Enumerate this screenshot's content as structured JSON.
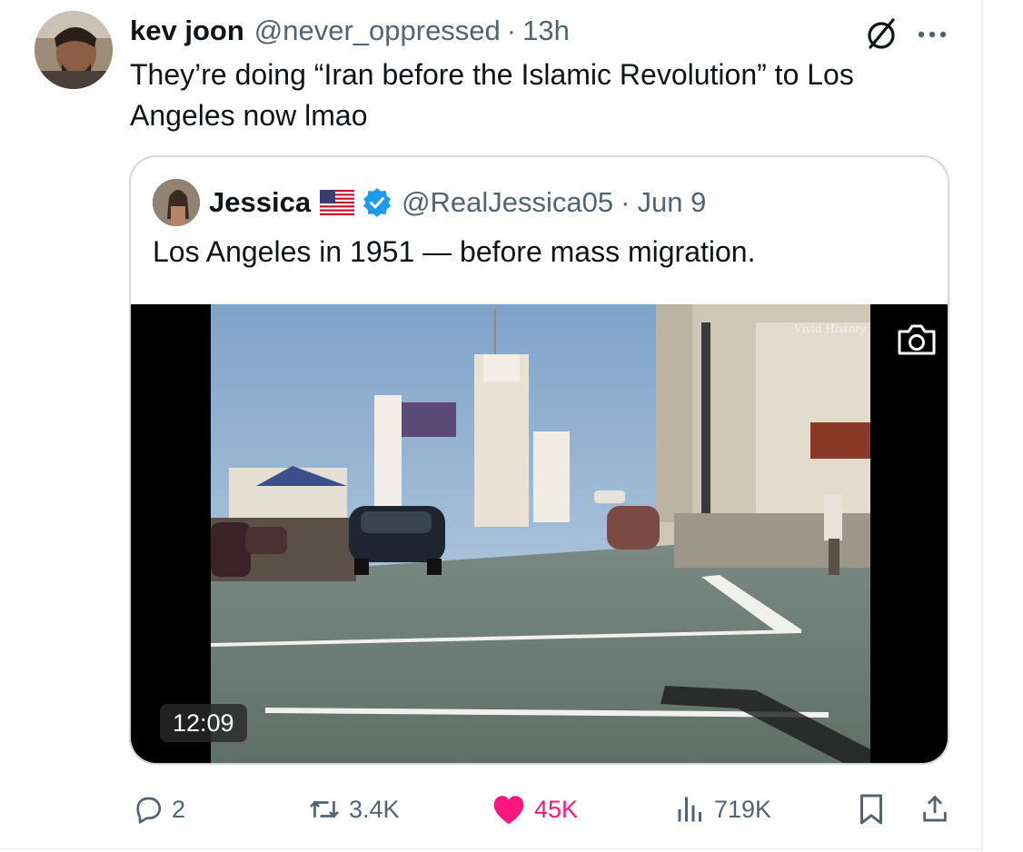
{
  "tweet": {
    "author_name": "kev joon",
    "author_handle": "@never_oppressed",
    "separator": "·",
    "time": "13h",
    "text": "They’re doing “Iran before the Islamic Revolution” to Los Angeles now lmao"
  },
  "quote": {
    "author_name": "Jessica",
    "author_handle": "@RealJessica05",
    "separator": "·",
    "time": "Jun 9",
    "text": "Los Angeles in 1951 — before mass migration.",
    "media": {
      "watermark": "Vivid History",
      "duration": "12:09"
    }
  },
  "actions": {
    "replies": "2",
    "reposts": "3.4K",
    "likes": "45K",
    "views": "719K"
  },
  "icons": {
    "header": [
      "grok-icon",
      "more-icon"
    ],
    "quote": [
      "us-flag-icon",
      "verified-badge-icon",
      "camera-icon"
    ],
    "actions": [
      "reply-icon",
      "repost-icon",
      "like-icon",
      "views-icon",
      "bookmark-icon",
      "share-icon"
    ]
  },
  "colors": {
    "primary_text": "#0f1419",
    "secondary_text": "#536471",
    "like": "#f91880",
    "verified": "#1d9bf0",
    "border": "#cfd9de"
  }
}
